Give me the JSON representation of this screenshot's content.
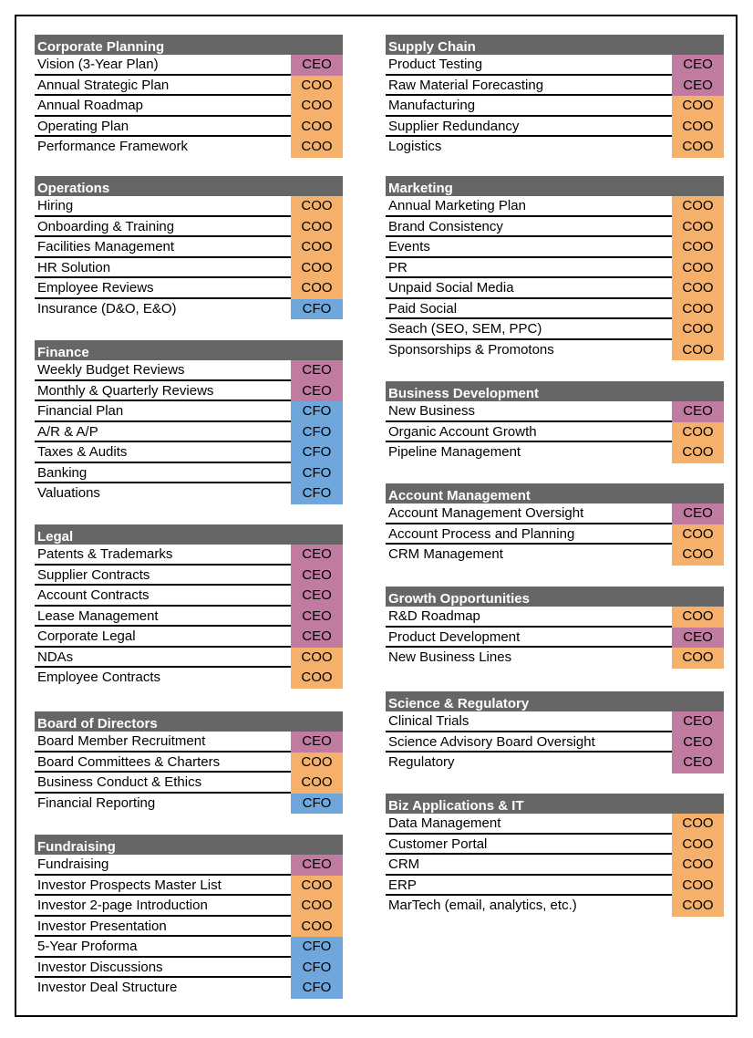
{
  "colors": {
    "CEO": "#C17BA0",
    "COO": "#F5B16B",
    "CFO": "#6FA6DC",
    "header": "#666666"
  },
  "left_sections": [
    {
      "title": "Corporate Planning",
      "rows": [
        {
          "label": "Vision (3-Year Plan)",
          "owner": "CEO"
        },
        {
          "label": "Annual Strategic Plan",
          "owner": "COO"
        },
        {
          "label": "Annual Roadmap",
          "owner": "COO"
        },
        {
          "label": "Operating Plan",
          "owner": "COO"
        },
        {
          "label": "Performance Framework",
          "owner": "COO"
        }
      ]
    },
    {
      "title": "Operations",
      "rows": [
        {
          "label": "Hiring",
          "owner": "COO"
        },
        {
          "label": "Onboarding & Training",
          "owner": "COO"
        },
        {
          "label": "Facilities Management",
          "owner": "COO"
        },
        {
          "label": "HR Solution",
          "owner": "COO"
        },
        {
          "label": "Employee Reviews",
          "owner": "COO"
        },
        {
          "label": "Insurance (D&O, E&O)",
          "owner": "CFO"
        }
      ]
    },
    {
      "title": "Finance",
      "rows": [
        {
          "label": "Weekly Budget Reviews",
          "owner": "CEO"
        },
        {
          "label": "Monthly & Quarterly Reviews",
          "owner": "CEO"
        },
        {
          "label": "Financial Plan",
          "owner": "CFO"
        },
        {
          "label": "A/R & A/P",
          "owner": "CFO"
        },
        {
          "label": "Taxes & Audits",
          "owner": "CFO"
        },
        {
          "label": "Banking",
          "owner": "CFO"
        },
        {
          "label": "Valuations",
          "owner": "CFO"
        }
      ]
    },
    {
      "title": "Legal",
      "rows": [
        {
          "label": "Patents & Trademarks",
          "owner": "CEO"
        },
        {
          "label": "Supplier Contracts",
          "owner": "CEO"
        },
        {
          "label": "Account Contracts",
          "owner": "CEO"
        },
        {
          "label": "Lease Management",
          "owner": "CEO"
        },
        {
          "label": "Corporate Legal",
          "owner": "CEO"
        },
        {
          "label": "NDAs",
          "owner": "COO"
        },
        {
          "label": "Employee Contracts",
          "owner": "COO"
        }
      ]
    },
    {
      "title": "Board of Directors",
      "rows": [
        {
          "label": "Board Member Recruitment",
          "owner": "CEO"
        },
        {
          "label": "Board Committees & Charters",
          "owner": "COO"
        },
        {
          "label": "Business Conduct & Ethics",
          "owner": "COO"
        },
        {
          "label": "Financial Reporting",
          "owner": "CFO"
        }
      ]
    },
    {
      "title": "Fundraising",
      "rows": [
        {
          "label": "Fundraising",
          "owner": "CEO"
        },
        {
          "label": "Investor Prospects Master List",
          "owner": "COO"
        },
        {
          "label": "Investor 2-page Introduction",
          "owner": "COO"
        },
        {
          "label": "Investor Presentation",
          "owner": "COO"
        },
        {
          "label": "5-Year Proforma",
          "owner": "CFO"
        },
        {
          "label": "Investor Discussions",
          "owner": "CFO"
        },
        {
          "label": "Investor Deal Structure",
          "owner": "CFO"
        }
      ]
    }
  ],
  "right_sections": [
    {
      "title": "Supply Chain",
      "rows": [
        {
          "label": "Product Testing",
          "owner": "CEO"
        },
        {
          "label": "Raw Material Forecasting",
          "owner": "CEO"
        },
        {
          "label": "Manufacturing",
          "owner": "COO"
        },
        {
          "label": "Supplier Redundancy",
          "owner": "COO"
        },
        {
          "label": "Logistics",
          "owner": "COO"
        }
      ]
    },
    {
      "title": "Marketing",
      "rows": [
        {
          "label": "Annual Marketing Plan",
          "owner": "COO"
        },
        {
          "label": "Brand Consistency",
          "owner": "COO"
        },
        {
          "label": "Events",
          "owner": "COO"
        },
        {
          "label": "PR",
          "owner": "COO"
        },
        {
          "label": "Unpaid Social Media",
          "owner": "COO"
        },
        {
          "label": "Paid Social",
          "owner": "COO"
        },
        {
          "label": "Seach (SEO, SEM, PPC)",
          "owner": "COO"
        },
        {
          "label": "Sponsorships & Promotons",
          "owner": "COO"
        }
      ]
    },
    {
      "title": "Business Development",
      "rows": [
        {
          "label": "New Business",
          "owner": "CEO"
        },
        {
          "label": "Organic Account Growth",
          "owner": "COO"
        },
        {
          "label": "Pipeline Management",
          "owner": "COO"
        }
      ]
    },
    {
      "title": "Account Management",
      "rows": [
        {
          "label": "Account Management Oversight",
          "owner": "CEO"
        },
        {
          "label": "Account Process and Planning",
          "owner": "COO"
        },
        {
          "label": "CRM Management",
          "owner": "COO"
        }
      ]
    },
    {
      "title": "Growth Opportunities",
      "rows": [
        {
          "label": "R&D Roadmap",
          "owner": "COO"
        },
        {
          "label": "Product Development",
          "owner": "CEO"
        },
        {
          "label": "New Business Lines",
          "owner": "COO"
        }
      ]
    },
    {
      "title": "Science & Regulatory",
      "rows": [
        {
          "label": "Clinical Trials",
          "owner": "CEO"
        },
        {
          "label": "Science Advisory Board Oversight",
          "owner": "CEO"
        },
        {
          "label": "Regulatory",
          "owner": "CEO"
        }
      ]
    },
    {
      "title": "Biz Applications & IT",
      "rows": [
        {
          "label": "Data Management",
          "owner": "COO"
        },
        {
          "label": "Customer Portal",
          "owner": "COO"
        },
        {
          "label": "CRM",
          "owner": "COO"
        },
        {
          "label": "ERP",
          "owner": "COO"
        },
        {
          "label": "MarTech (email, analytics, etc.)",
          "owner": "COO"
        }
      ]
    }
  ]
}
